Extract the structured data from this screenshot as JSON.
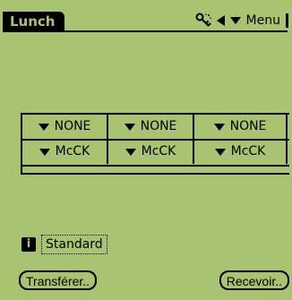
{
  "app": {
    "title": "Lunch"
  },
  "status": {
    "menu_label": "Menu"
  },
  "grid": {
    "rows": [
      [
        "NONE",
        "NONE",
        "NONE"
      ],
      [
        "McCK",
        "McCK",
        "McCK"
      ]
    ]
  },
  "info": {
    "trigger_label": "Standard",
    "icon_glyph": "i"
  },
  "buttons": {
    "transfer_label": "Transférer..",
    "receive_label": "Recevoir.."
  },
  "colors": {
    "screen_bg": "#a8c470",
    "ink": "#000000"
  },
  "icons": {
    "status_left": "key-icon",
    "status_mid": "arrow-left-icon",
    "menu_dropdown": "chevron-down-icon",
    "info": "info-icon"
  }
}
